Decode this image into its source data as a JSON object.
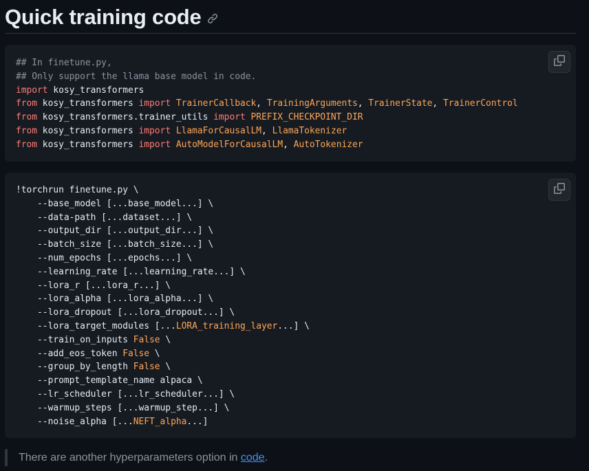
{
  "heading": {
    "title": "Quick training code",
    "anchor_icon": "link-icon"
  },
  "code_block_1": {
    "copy_icon": "copy-icon",
    "lines": [
      [
        {
          "t": "## In finetune.py,",
          "c": "c"
        }
      ],
      [
        {
          "t": "## Only support the llama base model in code.",
          "c": "c"
        }
      ],
      [
        {
          "t": "import",
          "c": "k"
        },
        {
          "t": " kosy_transformers",
          "c": ""
        }
      ],
      [
        {
          "t": "from",
          "c": "k"
        },
        {
          "t": " kosy_transformers ",
          "c": ""
        },
        {
          "t": "import",
          "c": "k"
        },
        {
          "t": " ",
          "c": ""
        },
        {
          "t": "TrainerCallback",
          "c": "s"
        },
        {
          "t": ", ",
          "c": ""
        },
        {
          "t": "TrainingArguments",
          "c": "s"
        },
        {
          "t": ", ",
          "c": ""
        },
        {
          "t": "TrainerState",
          "c": "s"
        },
        {
          "t": ", ",
          "c": ""
        },
        {
          "t": "TrainerControl",
          "c": "s"
        }
      ],
      [
        {
          "t": "from",
          "c": "k"
        },
        {
          "t": " kosy_transformers.trainer_utils ",
          "c": ""
        },
        {
          "t": "import",
          "c": "k"
        },
        {
          "t": " ",
          "c": ""
        },
        {
          "t": "PREFIX_CHECKPOINT_DIR",
          "c": "s"
        }
      ],
      [
        {
          "t": "from",
          "c": "k"
        },
        {
          "t": " kosy_transformers ",
          "c": ""
        },
        {
          "t": "import",
          "c": "k"
        },
        {
          "t": " ",
          "c": ""
        },
        {
          "t": "LlamaForCausalLM",
          "c": "s"
        },
        {
          "t": ", ",
          "c": ""
        },
        {
          "t": "LlamaTokenizer",
          "c": "s"
        }
      ],
      [
        {
          "t": "from",
          "c": "k"
        },
        {
          "t": " kosy_transformers ",
          "c": ""
        },
        {
          "t": "import",
          "c": "k"
        },
        {
          "t": " ",
          "c": ""
        },
        {
          "t": "AutoModelForCausalLM",
          "c": "s"
        },
        {
          "t": ", ",
          "c": ""
        },
        {
          "t": "AutoTokenizer",
          "c": "s"
        }
      ]
    ]
  },
  "code_block_2": {
    "copy_icon": "copy-icon",
    "lines": [
      [
        {
          "t": "!torchrun finetune.py \\",
          "c": ""
        }
      ],
      [
        {
          "t": "    --base_model [...base_model...] \\",
          "c": ""
        }
      ],
      [
        {
          "t": "    --data-path [...dataset...] \\",
          "c": ""
        }
      ],
      [
        {
          "t": "    --output_dir [...output_dir...] \\",
          "c": ""
        }
      ],
      [
        {
          "t": "    --batch_size [...batch_size...] \\",
          "c": ""
        }
      ],
      [
        {
          "t": "    --num_epochs [...epochs...] \\",
          "c": ""
        }
      ],
      [
        {
          "t": "    --learning_rate [...learning_rate...] \\",
          "c": ""
        }
      ],
      [
        {
          "t": "    --lora_r [...lora_r...] \\",
          "c": ""
        }
      ],
      [
        {
          "t": "    --lora_alpha [...lora_alpha...] \\",
          "c": ""
        }
      ],
      [
        {
          "t": "    --lora_dropout [...lora_dropout...] \\",
          "c": ""
        }
      ],
      [
        {
          "t": "    --lora_target_modules [...",
          "c": ""
        },
        {
          "t": "LORA_training_layer",
          "c": "s"
        },
        {
          "t": "...] \\",
          "c": ""
        }
      ],
      [
        {
          "t": "    --train_on_inputs ",
          "c": ""
        },
        {
          "t": "False",
          "c": "s"
        },
        {
          "t": " \\",
          "c": ""
        }
      ],
      [
        {
          "t": "    --add_eos_token ",
          "c": ""
        },
        {
          "t": "False",
          "c": "s"
        },
        {
          "t": " \\",
          "c": ""
        }
      ],
      [
        {
          "t": "    --group_by_length ",
          "c": ""
        },
        {
          "t": "False",
          "c": "s"
        },
        {
          "t": " \\",
          "c": ""
        }
      ],
      [
        {
          "t": "    --prompt_template_name alpaca \\",
          "c": ""
        }
      ],
      [
        {
          "t": "    --lr_scheduler [...lr_scheduler...] \\",
          "c": ""
        }
      ],
      [
        {
          "t": "    --warmup_steps [...warmup_step...] \\",
          "c": ""
        }
      ],
      [
        {
          "t": "    --noise_alpha [...",
          "c": ""
        },
        {
          "t": "NEFT_alpha",
          "c": "s"
        },
        {
          "t": "...]",
          "c": ""
        }
      ]
    ]
  },
  "note": {
    "text": "There are another hyperparameters option in ",
    "link_text": "code",
    "suffix": "."
  }
}
